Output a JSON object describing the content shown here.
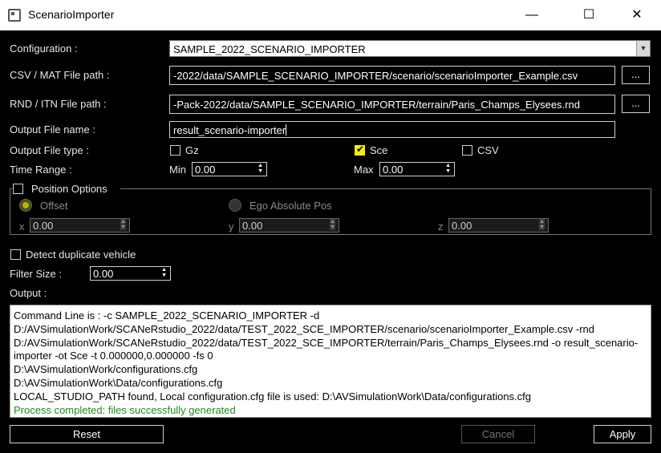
{
  "window": {
    "title": "ScenarioImporter",
    "minimize_glyph": "—",
    "maximize_glyph": "☐",
    "close_glyph": "✕"
  },
  "configuration": {
    "label": "Configuration :",
    "value": "SAMPLE_2022_SCENARIO_IMPORTER"
  },
  "csv_path": {
    "label": "CSV / MAT File path :",
    "value": "-2022/data/SAMPLE_SCENARIO_IMPORTER/scenario/scenarioImporter_Example.csv",
    "browse_label": "..."
  },
  "rnd_path": {
    "label": "RND / ITN File path :",
    "value": "-Pack-2022/data/SAMPLE_SCENARIO_IMPORTER/terrain/Paris_Champs_Elysees.rnd",
    "browse_label": "..."
  },
  "output_name": {
    "label": "Output File name :",
    "value": "result_scenario-importer"
  },
  "output_type": {
    "label": "Output File type :",
    "options": [
      {
        "label": "Gz",
        "checked": false
      },
      {
        "label": "Sce",
        "checked": true
      },
      {
        "label": "CSV",
        "checked": false
      }
    ]
  },
  "time_range": {
    "label": "Time Range :",
    "min_label": "Min",
    "min_value": "0.00",
    "max_label": "Max",
    "max_value": "0.00"
  },
  "position_options": {
    "label": "Position Options",
    "offset_label": "Offset",
    "ego_label": "Ego Absolute Pos",
    "x_label": "x",
    "x_value": "0.00",
    "y_label": "y",
    "y_value": "0.00",
    "z_label": "z",
    "z_value": "0.00"
  },
  "detect_duplicate": {
    "label": "Detect duplicate vehicle"
  },
  "filter_size": {
    "label": "Filter Size :",
    "value": "0.00"
  },
  "output": {
    "label": "Output :",
    "lines": [
      "Command Line is : -c SAMPLE_2022_SCENARIO_IMPORTER -d D:/AVSimulationWork/SCANeRstudio_2022/data/TEST_2022_SCE_IMPORTER/scenario/scenarioImporter_Example.csv -rnd D:/AVSimulationWork/SCANeRstudio_2022/data/TEST_2022_SCE_IMPORTER/terrain/Paris_Champs_Elysees.rnd -o result_scenario-importer -ot Sce -t 0.000000,0.000000 -fs 0",
      "D:\\AVSimulationWork/configurations.cfg",
      "D:\\AVSimulationWork\\Data/configurations.cfg",
      "LOCAL_STUDIO_PATH found, Local configuration.cfg file is used: D:\\AVSimulationWork\\Data/configurations.cfg"
    ],
    "success": "Process completed: files successfully generated",
    "success_color": "#1e8c1e"
  },
  "buttons": {
    "reset": "Reset",
    "cancel": "Cancel",
    "apply": "Apply"
  },
  "colors": {
    "accent_check": "#f2ef00",
    "background": "#000000"
  }
}
